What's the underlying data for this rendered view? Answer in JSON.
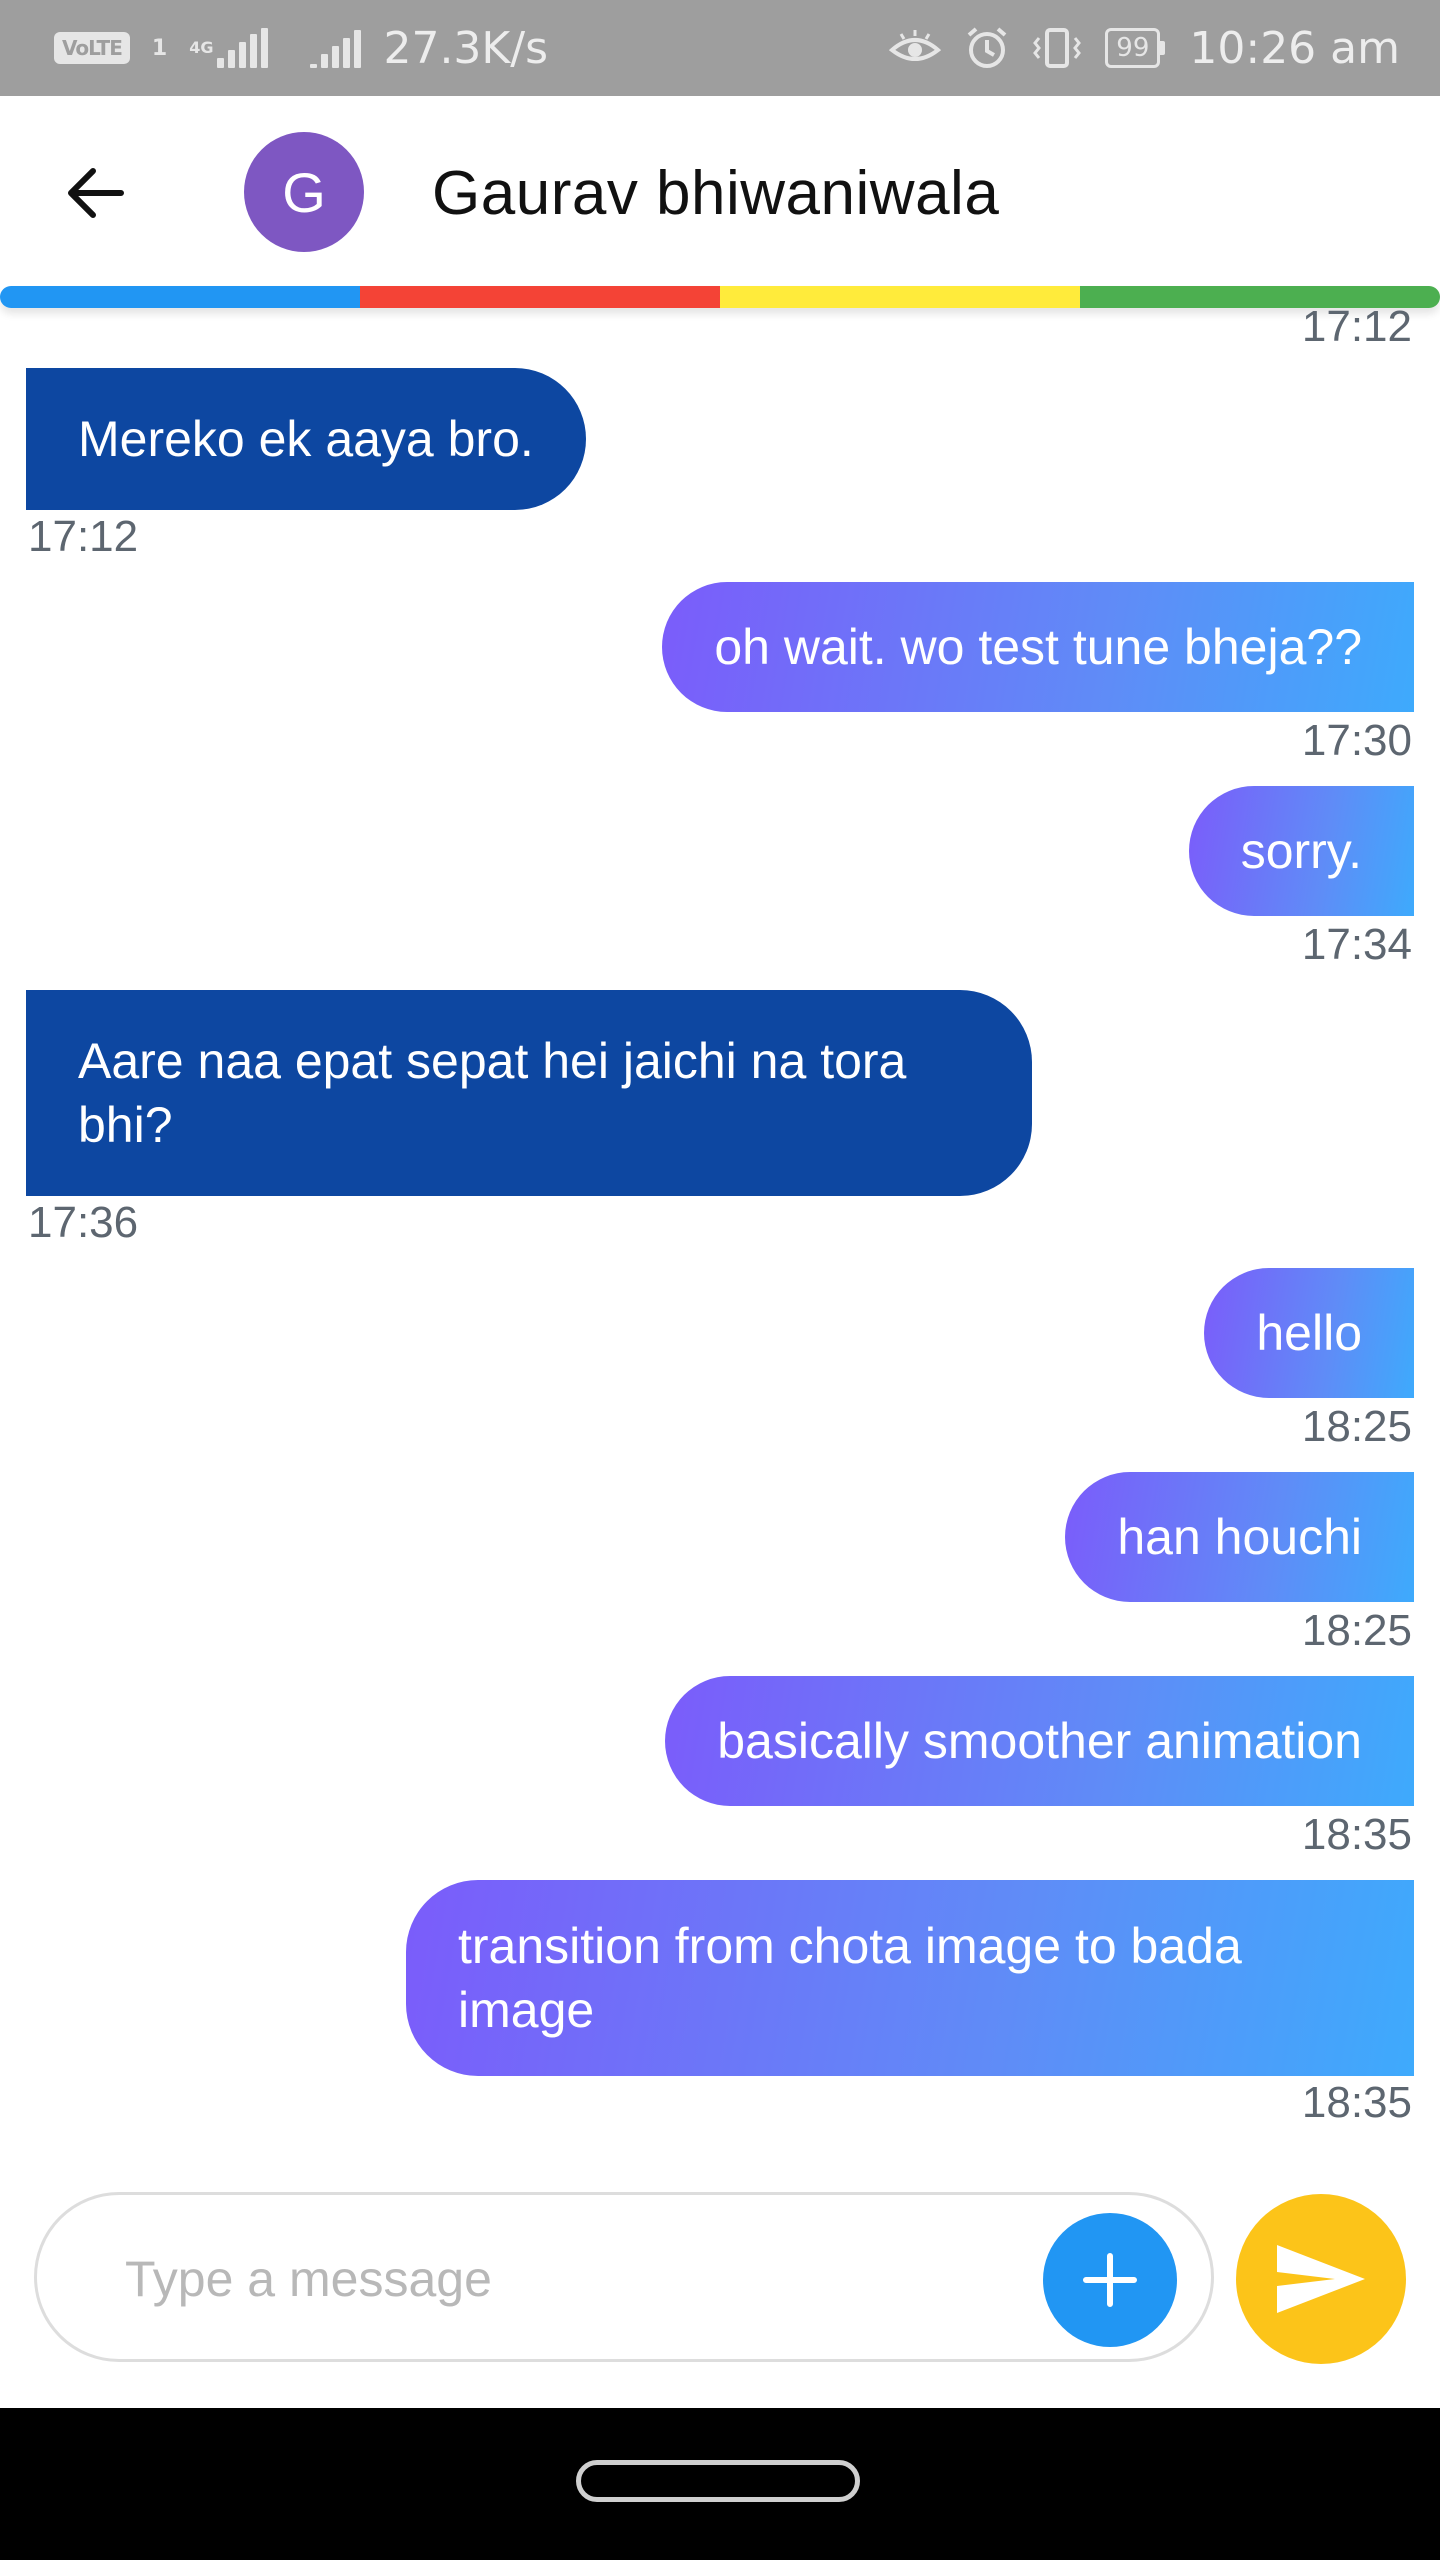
{
  "status_bar": {
    "volte": "VoLTE",
    "sim_slot": "1",
    "network_type": "4G",
    "net_speed": "27.3K/s",
    "battery": "99",
    "time": "10:26 am"
  },
  "header": {
    "avatar_letter": "G",
    "contact_name": "Gaurav bhiwaniwala",
    "avatar_color": "#7e57c2"
  },
  "top_timestamp": "17:12",
  "messages": [
    {
      "direction": "in",
      "text": "Mereko ek aaya bro.",
      "time": "17:12"
    },
    {
      "direction": "out",
      "text": "oh wait. wo test tune bheja??",
      "time": "17:30"
    },
    {
      "direction": "out",
      "text": "sorry.",
      "time": "17:34"
    },
    {
      "direction": "in",
      "text": "Aare naa epat sepat hei jaichi na tora bhi?",
      "time": "17:36"
    },
    {
      "direction": "out",
      "text": "hello",
      "time": "18:25"
    },
    {
      "direction": "out",
      "text": "han houchi",
      "time": "18:25"
    },
    {
      "direction": "out",
      "text": "basically smoother animation",
      "time": "18:35"
    },
    {
      "direction": "out",
      "text": "transition from chota image to bada image",
      "time": "18:35"
    }
  ],
  "composer": {
    "placeholder": "Type a message",
    "value": ""
  },
  "icons": {
    "back": "arrow-left-icon",
    "add": "plus-icon",
    "send": "send-icon"
  },
  "colors": {
    "incoming_bubble": "#0d47a1",
    "outgoing_gradient_start": "#7b5cfa",
    "outgoing_gradient_end": "#3eaafc",
    "add_button": "#2196f3",
    "send_button": "#fcc419",
    "rainbow": [
      "#2196f3",
      "#f44336",
      "#ffeb3b",
      "#4caf50"
    ]
  }
}
